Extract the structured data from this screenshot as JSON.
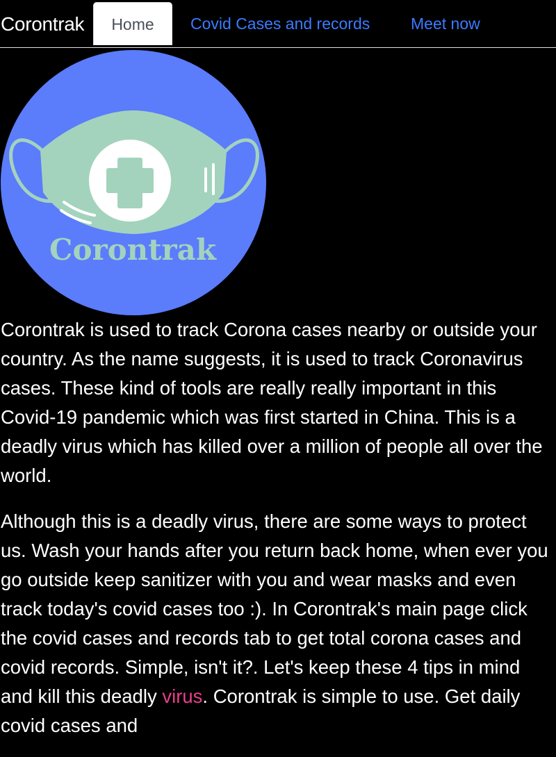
{
  "nav": {
    "brand": "Corontrak",
    "tabs": [
      {
        "label": "Home",
        "active": true
      },
      {
        "label": "Covid Cases and records",
        "active": false
      },
      {
        "label": "Meet now",
        "active": false
      }
    ]
  },
  "logo": {
    "text": "Corontrak",
    "colors": {
      "circle": "#5b7cfb",
      "mask": "#a3d3bd",
      "cross_bg": "#ffffff"
    }
  },
  "content": {
    "paragraph1": "Corontrak is used to track Corona cases nearby or outside your country. As the name suggests, it is used to track Coronavirus cases. These kind of tools are really really important in this Covid-19 pandemic which was first started in China. This is a deadly virus which has killed over a million of people all over the world.",
    "paragraph2_before_link": "Although this is a deadly virus, there are some ways to protect us. Wash your hands after you return back home, when ever you go outside keep sanitizer with you and wear masks and even track today's covid cases too :). In Corontrak's main page click the covid cases and records tab to get total corona cases and covid records. Simple, isn't it?. Let's keep these 4 tips in mind and kill this deadly ",
    "paragraph2_link": "virus",
    "paragraph2_after_link": ". Corontrak is simple to use. Get daily covid cases and"
  },
  "colors": {
    "background": "#000000",
    "text": "#ffffff",
    "link": "#3b7bff",
    "inline_link": "#e83e8c"
  }
}
